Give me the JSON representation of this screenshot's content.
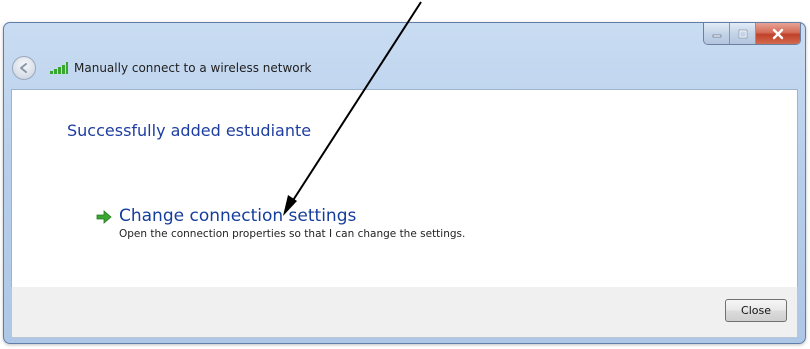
{
  "window": {
    "title": "Manually connect to a wireless network"
  },
  "content": {
    "success_message": "Successfully added estudiante",
    "option": {
      "title": "Change connection settings",
      "description": "Open the connection properties so that I can change the settings."
    }
  },
  "footer": {
    "close_label": "Close"
  },
  "icons": {
    "back": "back-arrow-icon",
    "signal": "wireless-signal-icon",
    "option_arrow": "green-arrow-icon",
    "minimize": "minimize-icon",
    "maximize": "maximize-icon",
    "close": "close-x-icon"
  },
  "colors": {
    "heading_blue": "#1e3da1",
    "link_blue": "#153e9c",
    "signal_green": "#3aa632",
    "close_red": "#c0412a"
  }
}
